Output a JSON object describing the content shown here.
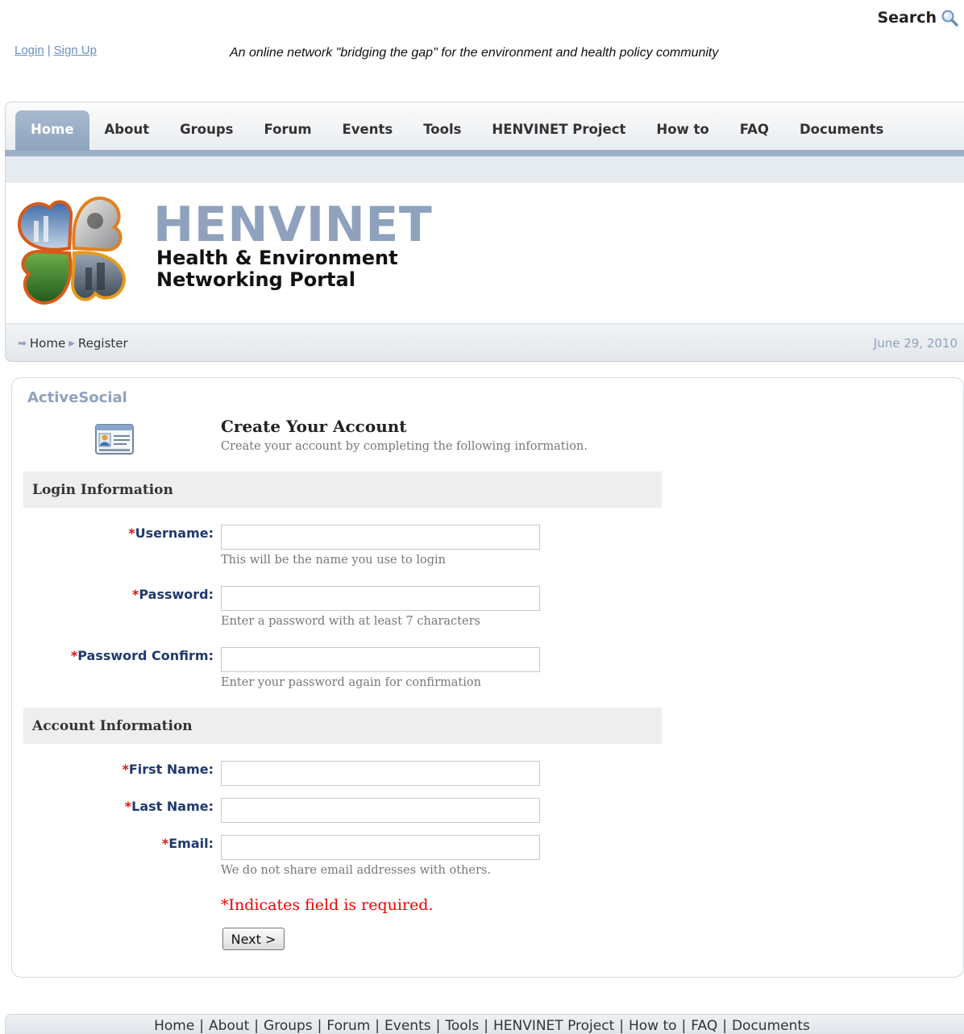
{
  "header": {
    "search_label": "Search",
    "login_link": "Login",
    "auth_separator": "|",
    "signup_link": "Sign Up",
    "tagline": "An online network \"bridging the gap\" for the environment and health policy community"
  },
  "nav": {
    "items": [
      {
        "label": "Home",
        "active": true
      },
      {
        "label": "About"
      },
      {
        "label": "Groups"
      },
      {
        "label": "Forum"
      },
      {
        "label": "Events"
      },
      {
        "label": "Tools"
      },
      {
        "label": "HENVINET Project"
      },
      {
        "label": "How to"
      },
      {
        "label": "FAQ"
      },
      {
        "label": "Documents"
      }
    ]
  },
  "banner": {
    "title": "HENVINET",
    "subtitle_line1": "Health & Environment",
    "subtitle_line2": "Networking Portal"
  },
  "breadcrumb": {
    "items": [
      "Home",
      "Register"
    ],
    "date": "June 29, 2010"
  },
  "panel": {
    "title": "ActiveSocial",
    "form_title": "Create Your Account",
    "form_description": "Create your account by completing the following information."
  },
  "sections": {
    "login": "Login Information",
    "account": "Account Information"
  },
  "fields": {
    "username": {
      "marker": "*",
      "label": "Username:",
      "value": "",
      "hint": "This will be the name you use to login"
    },
    "password": {
      "marker": "*",
      "label": "Password:",
      "value": "",
      "hint": "Enter a password with at least 7 characters"
    },
    "password_confirm": {
      "marker": "*",
      "label": "Password Confirm:",
      "value": "",
      "hint": "Enter your password again for confirmation"
    },
    "first_name": {
      "marker": "*",
      "label": "First Name:",
      "value": ""
    },
    "last_name": {
      "marker": "*",
      "label": "Last Name:",
      "value": ""
    },
    "email": {
      "marker": "*",
      "label": "Email:",
      "value": "",
      "hint": "We do not share email addresses with others."
    }
  },
  "required_note": "*Indicates field is required.",
  "next_button": "Next >",
  "footer": {
    "links": [
      "Home",
      "About",
      "Groups",
      "Forum",
      "Events",
      "Tools",
      "HENVINET Project",
      "How to",
      "FAQ",
      "Documents"
    ],
    "separator": "|"
  },
  "colors": {
    "accent": "#8fa2bd",
    "nav_active": "#9db0c6",
    "label": "#1f3a6e",
    "required": "#dd1111"
  }
}
